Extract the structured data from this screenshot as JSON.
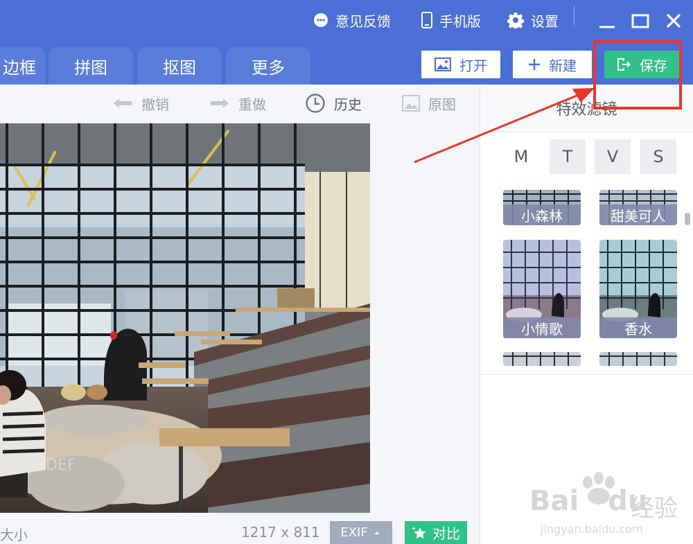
{
  "titlebar": {
    "feedback_label": "意见反馈",
    "mobile_label": "手机版",
    "settings_label": "设置"
  },
  "tabs": [
    {
      "label": "边框"
    },
    {
      "label": "拼图"
    },
    {
      "label": "抠图"
    },
    {
      "label": "更多"
    }
  ],
  "actions": {
    "open_label": "打开",
    "new_label": "新建",
    "save_label": "保存"
  },
  "toolbar": {
    "undo_label": "撤销",
    "redo_label": "重做",
    "history_label": "历史",
    "original_label": "原图"
  },
  "status": {
    "size_label": "大小",
    "dimensions": "1217 x 811",
    "exif_label": "EXIF",
    "compare_label": "对比"
  },
  "panel": {
    "title": "特效滤镜",
    "letter_tabs": [
      "M",
      "T",
      "V",
      "S"
    ],
    "filters": [
      {
        "label": "小森林"
      },
      {
        "label": "甜美可人"
      },
      {
        "label": "小情歌"
      },
      {
        "label": "香水"
      }
    ]
  },
  "watermark": {
    "brand": "Bai",
    "brand_suffix": "du",
    "product": "经验",
    "url": "jingyan.baidu.com"
  },
  "colors": {
    "topbar": "#4a6fd6",
    "save": "#34c08a",
    "highlight": "#e8362b"
  }
}
